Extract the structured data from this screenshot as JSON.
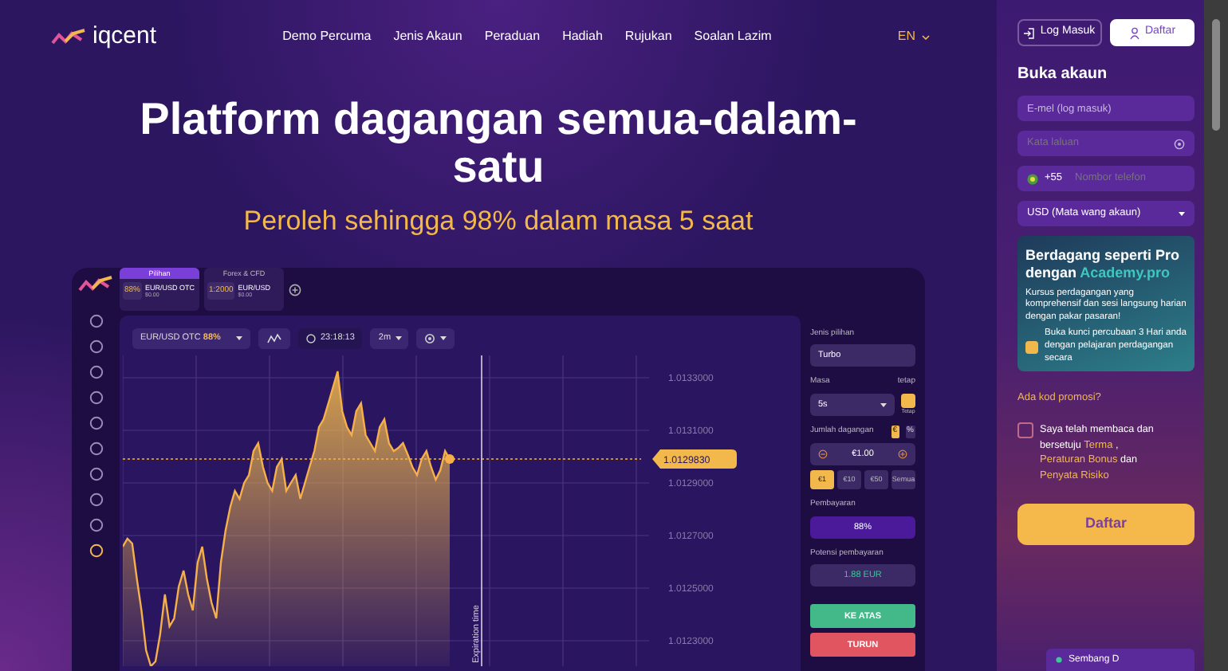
{
  "nav": {
    "logo": "iqcent",
    "links": [
      "Demo Percuma",
      "Jenis Akaun",
      "Peraduan",
      "Hadiah",
      "Rujukan",
      "Soalan Lazim"
    ],
    "language": "EN"
  },
  "hero": {
    "title": "Platform dagangan semua-dalam-satu",
    "subtitle": "Peroleh sehingga 98% dalam masa 5 saat"
  },
  "platform": {
    "rail_icons": [
      {
        "selected": false
      },
      {
        "selected": false
      },
      {
        "selected": false
      },
      {
        "selected": false
      },
      {
        "selected": false
      },
      {
        "selected": false
      },
      {
        "selected": false
      },
      {
        "selected": false
      },
      {
        "selected": false
      },
      {
        "selected": true
      }
    ],
    "asset_tabs": [
      {
        "header": "Pilihan",
        "payout": "88%",
        "asset": "EUR/USD OTC",
        "balance": "$0.00",
        "selected": true
      },
      {
        "header": "Forex & CFD",
        "payout": "1:2000",
        "asset": "EUR/USD",
        "balance": "$0.00",
        "selected": false
      }
    ],
    "toolbar": {
      "asset": "EUR/USD OTC",
      "payout": "88%",
      "time": "23:18:13",
      "timeframe": "2m"
    },
    "chart": {
      "current_price": "1.0129830",
      "price_labels": [
        "1.0133000",
        "1.0131000",
        "1.0129000",
        "1.0127000",
        "1.0125000",
        "1.0123000"
      ],
      "expiration_label": "Expiration time"
    },
    "trade_panel": {
      "option_type_label": "Jenis pilihan",
      "option_type": "Turbo",
      "time_label": "Masa",
      "fixed_label": "tetap",
      "time_value": "5s",
      "fixed_toggle": {
        "label": "Tetap",
        "on": true
      },
      "amount_label": "Jumlah dagangan",
      "amount_modes": [
        {
          "label": "€",
          "selected": true
        },
        {
          "label": "%",
          "selected": false
        }
      ],
      "amount": "€1.00",
      "quick_amounts": [
        {
          "label": "€1",
          "selected": true
        },
        {
          "label": "€10",
          "selected": false
        },
        {
          "label": "€50",
          "selected": false
        },
        {
          "label": "Semua",
          "selected": false
        }
      ],
      "payout_label": "Pembayaran",
      "payout": "88%",
      "potential_label": "Potensi pembayaran",
      "potential": "1.88 EUR",
      "up_button": "KE ATAS",
      "down_button": "TURUN"
    }
  },
  "signup": {
    "auth_tabs": [
      {
        "label": "Log Masuk",
        "selected": false
      },
      {
        "label": "Daftar",
        "selected": true
      }
    ],
    "title": "Buka akaun",
    "email_placeholder": "E-mel (log masuk)",
    "password_placeholder": "Kata laluan",
    "phone_code": "+55",
    "phone_placeholder": "Nombor telefon",
    "currency": "USD (Mata wang akaun)",
    "promo_card": {
      "title": "Berdagang seperti Pro dengan",
      "brand": "Academy.pro",
      "text": "Kursus perdagangan yang komprehensif dan sesi langsung harian dengan pakar pasaran!",
      "checkbox_label": "Buka kunci percubaan 3 Hari anda dengan pelajaran perdagangan secara",
      "checked": true
    },
    "promo_link": "Ada kod promosi?",
    "agree": {
      "checked": false,
      "text": "Saya telah membaca dan bersetuju",
      "terms": "Terma",
      "comma": ",",
      "bonus": "Peraturan Bonus",
      "and": "dan",
      "risk": "Penyata Risiko"
    },
    "submit": "Daftar",
    "chat": "Sembang D"
  }
}
